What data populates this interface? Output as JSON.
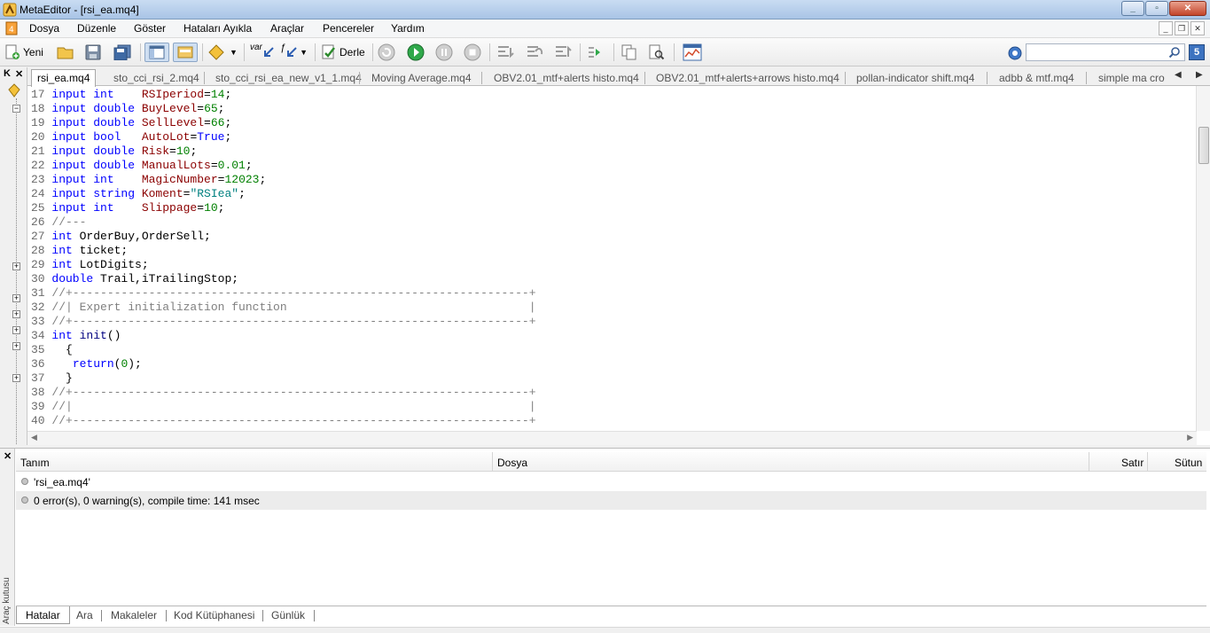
{
  "window": {
    "title": "MetaEditor - [rsi_ea.mq4]"
  },
  "menu": [
    "Dosya",
    "Düzenle",
    "Göster",
    "Hataları Ayıkla",
    "Araçlar",
    "Pencereler",
    "Yardım"
  ],
  "toolbar": {
    "new_label": "Yeni",
    "compile_label": "Derle",
    "var_label": "var",
    "search_placeholder": "",
    "badge": "5"
  },
  "tabs": [
    "rsi_ea.mq4",
    "sto_cci_rsi_2.mq4",
    "sto_cci_rsi_ea_new_v1_1.mq4",
    "Moving Average.mq4",
    "OBV2.01_mtf+alerts histo.mq4",
    "OBV2.01_mtf+alerts+arrows histo.mq4",
    "pollan-indicator shift.mq4",
    "adbb & mtf.mq4",
    "simple ma cro"
  ],
  "code_lines": [
    {
      "n": "17",
      "parts": [
        [
          "kw",
          "input "
        ],
        [
          "tp",
          "int    "
        ],
        [
          "var",
          "RSIperiod"
        ],
        [
          "",
          "="
        ],
        [
          "num",
          "14"
        ],
        [
          "",
          ";"
        ]
      ]
    },
    {
      "n": "18",
      "parts": [
        [
          "kw",
          "input "
        ],
        [
          "tp",
          "double "
        ],
        [
          "var",
          "BuyLevel"
        ],
        [
          "",
          "="
        ],
        [
          "num",
          "65"
        ],
        [
          "",
          ";"
        ]
      ]
    },
    {
      "n": "19",
      "parts": [
        [
          "kw",
          "input "
        ],
        [
          "tp",
          "double "
        ],
        [
          "var",
          "SellLevel"
        ],
        [
          "",
          "="
        ],
        [
          "num",
          "66"
        ],
        [
          "",
          ";"
        ]
      ]
    },
    {
      "n": "20",
      "parts": [
        [
          "kw",
          "input "
        ],
        [
          "tp",
          "bool   "
        ],
        [
          "var",
          "AutoLot"
        ],
        [
          "",
          "="
        ],
        [
          "kw",
          "True"
        ],
        [
          "",
          ";"
        ]
      ]
    },
    {
      "n": "21",
      "parts": [
        [
          "kw",
          "input "
        ],
        [
          "tp",
          "double "
        ],
        [
          "var",
          "Risk"
        ],
        [
          "",
          "="
        ],
        [
          "num",
          "10"
        ],
        [
          "",
          ";"
        ]
      ]
    },
    {
      "n": "22",
      "parts": [
        [
          "kw",
          "input "
        ],
        [
          "tp",
          "double "
        ],
        [
          "var",
          "ManualLots"
        ],
        [
          "",
          "="
        ],
        [
          "num",
          "0.01"
        ],
        [
          "",
          ";"
        ]
      ]
    },
    {
      "n": "23",
      "parts": [
        [
          "kw",
          "input "
        ],
        [
          "tp",
          "int    "
        ],
        [
          "var",
          "MagicNumber"
        ],
        [
          "",
          "="
        ],
        [
          "num",
          "12023"
        ],
        [
          "",
          ";"
        ]
      ]
    },
    {
      "n": "24",
      "parts": [
        [
          "kw",
          "input "
        ],
        [
          "tp",
          "string "
        ],
        [
          "var",
          "Koment"
        ],
        [
          "",
          "="
        ],
        [
          "str",
          "\"RSIea\""
        ],
        [
          "",
          ";"
        ]
      ]
    },
    {
      "n": "25",
      "parts": [
        [
          "kw",
          "input "
        ],
        [
          "tp",
          "int    "
        ],
        [
          "var",
          "Slippage"
        ],
        [
          "",
          "="
        ],
        [
          "num",
          "10"
        ],
        [
          "",
          ";"
        ]
      ]
    },
    {
      "n": "26",
      "parts": [
        [
          "cm",
          "//---"
        ]
      ]
    },
    {
      "n": "27",
      "parts": [
        [
          "tp",
          "int "
        ],
        [
          "",
          "OrderBuy,OrderSell;"
        ]
      ]
    },
    {
      "n": "28",
      "parts": [
        [
          "tp",
          "int "
        ],
        [
          "",
          "ticket;"
        ]
      ]
    },
    {
      "n": "29",
      "parts": [
        [
          "tp",
          "int "
        ],
        [
          "",
          "LotDigits;"
        ]
      ]
    },
    {
      "n": "30",
      "parts": [
        [
          "tp",
          "double "
        ],
        [
          "",
          "Trail,iTrailingStop;"
        ]
      ]
    },
    {
      "n": "31",
      "parts": [
        [
          "cm",
          "//+------------------------------------------------------------------+"
        ]
      ]
    },
    {
      "n": "32",
      "parts": [
        [
          "cm",
          "//| Expert initialization function                                   |"
        ]
      ]
    },
    {
      "n": "33",
      "parts": [
        [
          "cm",
          "//+------------------------------------------------------------------+"
        ]
      ]
    },
    {
      "n": "34",
      "parts": [
        [
          "tp",
          "int "
        ],
        [
          "fn",
          "init"
        ],
        [
          "",
          "()"
        ]
      ]
    },
    {
      "n": "35",
      "parts": [
        [
          "",
          "  {"
        ]
      ]
    },
    {
      "n": "36",
      "parts": [
        [
          "",
          "   "
        ],
        [
          "kw",
          "return"
        ],
        [
          "",
          "("
        ],
        [
          "num",
          "0"
        ],
        [
          "",
          ");"
        ]
      ]
    },
    {
      "n": "37",
      "parts": [
        [
          "",
          "  }"
        ]
      ]
    },
    {
      "n": "38",
      "parts": [
        [
          "cm",
          "//+------------------------------------------------------------------+"
        ]
      ]
    },
    {
      "n": "39",
      "parts": [
        [
          "cm",
          "//|                                                                  |"
        ]
      ]
    },
    {
      "n": "40",
      "parts": [
        [
          "cm",
          "//+------------------------------------------------------------------+"
        ]
      ]
    }
  ],
  "toolbox": {
    "vertical_label": "Araç kutusu",
    "columns": {
      "description": "Tanım",
      "file": "Dosya",
      "line": "Satır",
      "column": "Sütun"
    },
    "rows": [
      "'rsi_ea.mq4'",
      "0 error(s), 0 warning(s), compile time: 141 msec"
    ],
    "tabs": [
      "Hatalar",
      "Ara",
      "Makaleler",
      "Kod Kütüphanesi",
      "Günlük"
    ]
  },
  "colors": {
    "keyword": "#0000ff",
    "variable": "#8b0000",
    "number": "#008000",
    "comment": "#808080"
  }
}
